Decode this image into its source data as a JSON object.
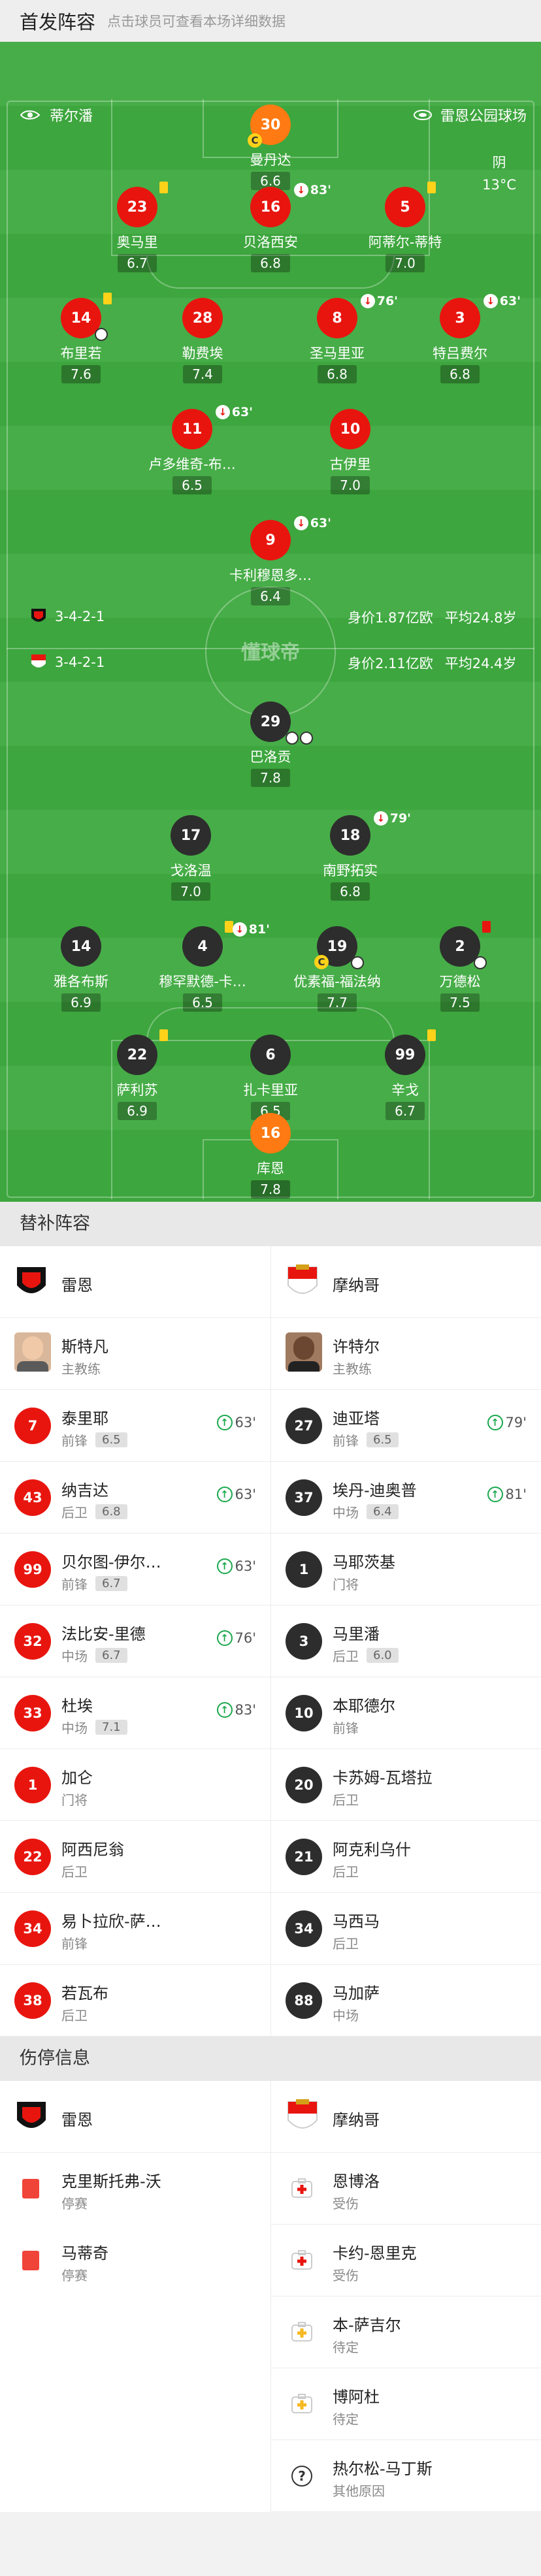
{
  "header": {
    "title": "首发阵容",
    "hint": "点击球员可查看本场详细数据"
  },
  "pitch": {
    "home_team": "蒂尔潘",
    "away_team": "雷恩公园球场",
    "weather": "阴",
    "temp": "13°C",
    "home_formation": "3-4-2-1",
    "home_value": "身价1.87亿欧",
    "home_age": "平均24.8岁",
    "away_formation": "3-4-2-1",
    "away_value": "身价2.11亿欧",
    "away_age": "平均24.4岁",
    "watermark": "懂球帝"
  },
  "home_players": [
    {
      "num": "30",
      "name": "曼丹达",
      "rate": "6.6"
    },
    {
      "num": "23",
      "name": "奥马里",
      "rate": "6.7"
    },
    {
      "num": "16",
      "name": "贝洛西安",
      "rate": "6.8",
      "sub": "83'"
    },
    {
      "num": "5",
      "name": "阿蒂尔-蒂特",
      "rate": "7.0"
    },
    {
      "num": "14",
      "name": "布里若",
      "rate": "7.6"
    },
    {
      "num": "28",
      "name": "勒费埃",
      "rate": "7.4"
    },
    {
      "num": "8",
      "name": "圣马里亚",
      "rate": "6.8",
      "sub": "76'"
    },
    {
      "num": "3",
      "name": "特吕费尔",
      "rate": "6.8",
      "sub": "63'"
    },
    {
      "num": "11",
      "name": "卢多维奇-布…",
      "rate": "6.5",
      "sub": "63'"
    },
    {
      "num": "10",
      "name": "古伊里",
      "rate": "7.0"
    },
    {
      "num": "9",
      "name": "卡利穆恩多…",
      "rate": "6.4",
      "sub": "63'"
    }
  ],
  "away_players": [
    {
      "num": "29",
      "name": "巴洛贡",
      "rate": "7.8"
    },
    {
      "num": "17",
      "name": "戈洛温",
      "rate": "7.0"
    },
    {
      "num": "18",
      "name": "南野拓实",
      "rate": "6.8",
      "sub": "79'"
    },
    {
      "num": "14",
      "name": "雅各布斯",
      "rate": "6.9"
    },
    {
      "num": "4",
      "name": "穆罕默德-卡…",
      "rate": "6.5",
      "sub": "81'"
    },
    {
      "num": "19",
      "name": "优素福-福法纳",
      "rate": "7.7"
    },
    {
      "num": "2",
      "name": "万德松",
      "rate": "7.5"
    },
    {
      "num": "22",
      "name": "萨利苏",
      "rate": "6.9"
    },
    {
      "num": "6",
      "name": "扎卡里亚",
      "rate": "6.5"
    },
    {
      "num": "99",
      "name": "辛戈",
      "rate": "6.7"
    },
    {
      "num": "16",
      "name": "库恩",
      "rate": "7.8"
    }
  ],
  "subs": {
    "title": "替补阵容",
    "home_team": "雷恩",
    "away_team": "摩纳哥",
    "home_coach": {
      "name": "斯特凡",
      "role": "主教练"
    },
    "away_coach": {
      "name": "许特尔",
      "role": "主教练"
    },
    "home": [
      {
        "num": "7",
        "name": "泰里耶",
        "pos": "前锋",
        "rate": "6.5",
        "sub": "63'"
      },
      {
        "num": "43",
        "name": "纳吉达",
        "pos": "后卫",
        "rate": "6.8",
        "sub": "63'"
      },
      {
        "num": "99",
        "name": "贝尔图-伊尔…",
        "pos": "前锋",
        "rate": "6.7",
        "sub": "63'"
      },
      {
        "num": "32",
        "name": "法比安-里德",
        "pos": "中场",
        "rate": "6.7",
        "sub": "76'"
      },
      {
        "num": "33",
        "name": "杜埃",
        "pos": "中场",
        "rate": "7.1",
        "sub": "83'"
      },
      {
        "num": "1",
        "name": "加仑",
        "pos": "门将"
      },
      {
        "num": "22",
        "name": "阿西尼翁",
        "pos": "后卫"
      },
      {
        "num": "34",
        "name": "易卜拉欣-萨…",
        "pos": "前锋"
      },
      {
        "num": "38",
        "name": "若瓦布",
        "pos": "后卫"
      }
    ],
    "away": [
      {
        "num": "27",
        "name": "迪亚塔",
        "pos": "前锋",
        "rate": "6.5",
        "sub": "79'"
      },
      {
        "num": "37",
        "name": "埃丹-迪奥普",
        "pos": "中场",
        "rate": "6.4",
        "sub": "81'"
      },
      {
        "num": "1",
        "name": "马耶茨基",
        "pos": "门将"
      },
      {
        "num": "3",
        "name": "马里潘",
        "pos": "后卫",
        "rate": "6.0"
      },
      {
        "num": "10",
        "name": "本耶德尔",
        "pos": "前锋"
      },
      {
        "num": "20",
        "name": "卡苏姆-瓦塔拉",
        "pos": "后卫"
      },
      {
        "num": "21",
        "name": "阿克利乌什",
        "pos": "后卫"
      },
      {
        "num": "34",
        "name": "马西马",
        "pos": "后卫"
      },
      {
        "num": "88",
        "name": "马加萨",
        "pos": "中场"
      }
    ]
  },
  "injuries": {
    "title": "伤停信息",
    "home_team": "雷恩",
    "away_team": "摩纳哥",
    "home": [
      {
        "name": "克里斯托弗-沃",
        "status": "停赛",
        "icon": "red-card"
      },
      {
        "name": "马蒂奇",
        "status": "停赛",
        "icon": "red-card"
      }
    ],
    "away": [
      {
        "name": "恩博洛",
        "status": "受伤",
        "icon": "medkit-red"
      },
      {
        "name": "卡约-恩里克",
        "status": "受伤",
        "icon": "medkit-red"
      },
      {
        "name": "本-萨吉尔",
        "status": "待定",
        "icon": "medkit-yellow"
      },
      {
        "name": "博阿杜",
        "status": "待定",
        "icon": "medkit-yellow"
      },
      {
        "name": "热尔松-马丁斯",
        "status": "其他原因",
        "icon": "question"
      }
    ]
  },
  "colors": {
    "home": "#e8150f",
    "away": "#2d2d2d",
    "gk": "#ff7a12",
    "pitch": "#3da63e",
    "sub_in": "#19a84b"
  }
}
